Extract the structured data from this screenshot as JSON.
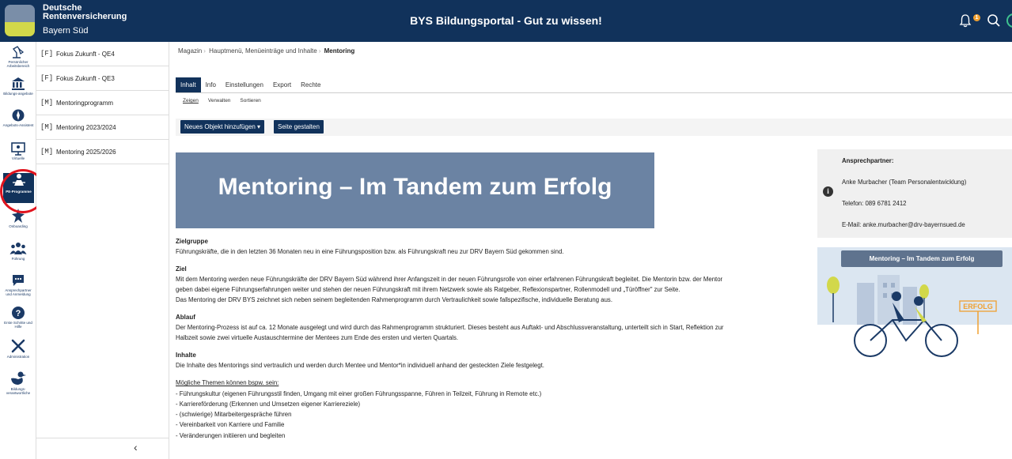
{
  "header": {
    "org_line1": "Deutsche",
    "org_line2": "Rentenversicherung",
    "org_region": "Bayern Süd",
    "app_title": "BYS Bildungsportal - Gut zu wissen!",
    "notification_count": "1"
  },
  "rail": {
    "items": [
      {
        "label": "Persönlicher Arbeitsbereich",
        "icon": "desk-lamp-icon"
      },
      {
        "label": "Bildungs-angebote",
        "icon": "institution-icon"
      },
      {
        "label": "Angebots-Assistent",
        "icon": "compass-icon"
      },
      {
        "label": "Virtuelle",
        "icon": "screen-icon"
      },
      {
        "label": "PE-Programme",
        "icon": "mentoring-icon"
      },
      {
        "label": "Onboarding",
        "icon": "onboarding-icon"
      },
      {
        "label": "Führung",
        "icon": "people-icon"
      },
      {
        "label": "Ansprechpartner und Anmeldung",
        "icon": "chat-icon"
      },
      {
        "label": "Erste Schritte und Hilfe",
        "icon": "help-icon"
      },
      {
        "label": "Administration",
        "icon": "tools-icon"
      },
      {
        "label": "Bildungs-verantwortliche",
        "icon": "duck-icon"
      }
    ]
  },
  "subnav": {
    "items": [
      {
        "mark": "[F]",
        "label": "Fokus Zukunft - QE4"
      },
      {
        "mark": "[F]",
        "label": "Fokus Zukunft - QE3"
      },
      {
        "mark": "[M]",
        "label": "Mentoringprogramm"
      },
      {
        "mark": "[M]",
        "label": "Mentoring 2023/2024"
      },
      {
        "mark": "[M]",
        "label": "Mentoring 2025/2026"
      }
    ],
    "collapse": "‹"
  },
  "breadcrumb": {
    "items": [
      "Magazin",
      "Hauptmenü, Menüeinträge und Inhalte"
    ],
    "current": "Mentoring"
  },
  "tabs": [
    "Inhalt",
    "Info",
    "Einstellungen",
    "Export",
    "Rechte"
  ],
  "subtabs": [
    "Zeigen",
    "Verwalten",
    "Sortieren"
  ],
  "toolbar": {
    "new_object": "Neues Objekt hinzufügen ▾",
    "design_page": "Seite gestalten"
  },
  "banner": "Mentoring – Im Tandem zum Erfolg",
  "content": {
    "zielgruppe_title": "Zielgruppe",
    "zielgruppe_text": "Führungskräfte, die in den letzten 36 Monaten neu in eine Führungsposition bzw. als Führungskraft neu zur DRV Bayern Süd gekommen sind.",
    "ziel_title": "Ziel",
    "ziel_text1": "Mit dem Mentoring werden neue Führungskräfte der DRV Bayern Süd während ihrer Anfangszeit in der neuen Führungsrolle von einer erfahrenen Führungskraft begleitet. Die Mentorin bzw. der Mentor",
    "ziel_text2": "geben dabei eigene Führungserfahrungen weiter und stehen der neuen Führungskraft mit ihrem Netzwerk sowie als Ratgeber, Reflexionspartner, Rollenmodell und „Türöffner\" zur Seite.",
    "ziel_text3": "Das Mentoring der DRV BYS zeichnet sich neben seinem begleitenden Rahmenprogramm durch Vertraulichkeit sowie fallspezifische, individuelle Beratung aus.",
    "ablauf_title": "Ablauf",
    "ablauf_text1": "Der Mentoring-Prozess ist auf ca. 12 Monate ausgelegt und wird durch das Rahmenprogramm strukturiert. Dieses besteht aus Auftakt- und Abschlussveranstaltung, unterteilt sich in Start, Reflektion zur",
    "ablauf_text2": "Halbzeit sowie zwei virtuelle Austauschtermine der Mentees zum Ende des ersten und vierten Quartals.",
    "inhalte_title": "Inhalte",
    "inhalte_text": "Die Inhalte des Mentorings sind vertraulich und werden durch Mentee und Mentor*in individuell anhand der gesteckten Ziele festgelegt.",
    "themen_title": "Mögliche Themen können bspw. sein:",
    "themen": [
      "- Führungskultur (eigenen Führungsstil finden, Umgang mit einer großen Führungsspanne, Führen in Teilzeit, Führung in Remote etc.)",
      "- Karriereförderung (Erkennen und Umsetzen eigener Karriereziele)",
      "- (schwierige) Mitarbeitergespräche führen",
      "- Vereinbarkeit von Karriere und Familie",
      "- Veränderungen initiieren und begleiten"
    ]
  },
  "contact": {
    "title": "Ansprechpartner:",
    "name": "Anke Murbacher (Team Personalentwicklung)",
    "phone": "Telefon: 089 6781 2412",
    "email": "E-Mail: anke.murbacher@drv-bayernsued.de"
  },
  "illustration": {
    "title": "Mentoring – Im Tandem zum Erfolg",
    "sign": "ERFOLG"
  },
  "colors": {
    "navy": "#11325b",
    "banner": "#6b83a3",
    "highlight": "#e0141e"
  }
}
